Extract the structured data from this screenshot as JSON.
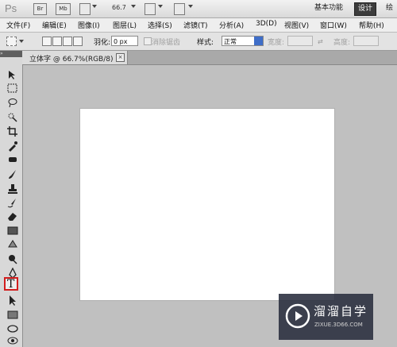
{
  "app": {
    "logo": "Ps",
    "bridge_label": "Br",
    "minibridge_label": "Mb",
    "zoom": "66.7"
  },
  "workspace": {
    "essentials": "基本功能",
    "design": "设计",
    "painting": "绘"
  },
  "menu": [
    "文件(F)",
    "编辑(E)",
    "图像(I)",
    "图层(L)",
    "选择(S)",
    "滤镜(T)",
    "分析(A)",
    "3D(D)",
    "视图(V)",
    "窗口(W)",
    "帮助(H)"
  ],
  "options": {
    "feather_label": "羽化:",
    "feather_value": "0 px",
    "antialias_label": "消除锯齿",
    "style_label": "样式:",
    "style_value": "正常",
    "width_label": "宽度:",
    "height_label": "高度:"
  },
  "document": {
    "tab_title": "立体字 @ 66.7%(RGB/8)",
    "close_glyph": "×"
  },
  "tools": [
    {
      "name": "move-tool-icon"
    },
    {
      "name": "rect-marquee-tool-icon"
    },
    {
      "name": "lasso-tool-icon"
    },
    {
      "name": "quick-select-tool-icon"
    },
    {
      "name": "crop-tool-icon"
    },
    {
      "name": "eyedropper-tool-icon"
    },
    {
      "name": "spot-healing-tool-icon"
    },
    {
      "name": "brush-tool-icon"
    },
    {
      "name": "clone-stamp-tool-icon"
    },
    {
      "name": "history-brush-tool-icon"
    },
    {
      "name": "eraser-tool-icon"
    },
    {
      "name": "gradient-tool-icon"
    },
    {
      "name": "blur-tool-icon"
    },
    {
      "name": "dodge-tool-icon"
    },
    {
      "name": "pen-tool-icon"
    },
    {
      "name": "type-tool-icon",
      "label": "T",
      "selected": true
    },
    {
      "name": "path-select-tool-icon"
    },
    {
      "name": "rectangle-shape-tool-icon"
    },
    {
      "name": "3d-rotate-tool-icon"
    },
    {
      "name": "3d-orbit-tool-icon"
    }
  ],
  "watermark": {
    "title": "溜溜自学",
    "url": "ZIXUE.3D66.COM"
  },
  "colors": {
    "selected_tool_border": "#d21d1d",
    "canvas": "#ffffff",
    "workspace_bg": "#c0c0c0"
  }
}
